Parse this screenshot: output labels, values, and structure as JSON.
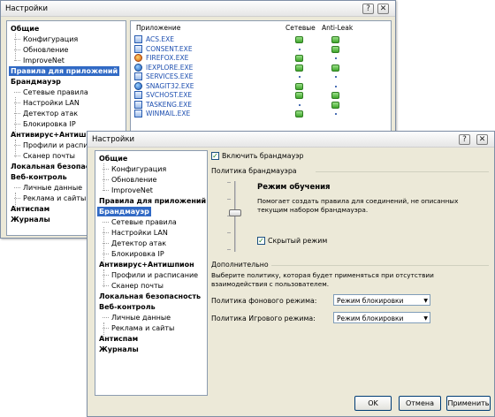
{
  "back_window": {
    "title": "Настройки",
    "title_buttons": [
      "?",
      "✕"
    ],
    "tree": [
      {
        "label": "Общие",
        "kind": "bold"
      },
      {
        "label": "Конфигурация",
        "kind": "child"
      },
      {
        "label": "Обновление",
        "kind": "child"
      },
      {
        "label": "ImproveNet",
        "kind": "child"
      },
      {
        "label": "Правила для приложений",
        "kind": "selected"
      },
      {
        "label": "Брандмауэр",
        "kind": "bold"
      },
      {
        "label": "Сетевые правила",
        "kind": "child"
      },
      {
        "label": "Настройки LAN",
        "kind": "child"
      },
      {
        "label": "Детектор атак",
        "kind": "child"
      },
      {
        "label": "Блокировка IP",
        "kind": "child"
      },
      {
        "label": "Антивирус+Антишпион",
        "kind": "bold"
      },
      {
        "label": "Профили и расписа",
        "kind": "child"
      },
      {
        "label": "Сканер почты",
        "kind": "child"
      },
      {
        "label": "Локальная безопаснос",
        "kind": "bold"
      },
      {
        "label": "Веб-контроль",
        "kind": "bold"
      },
      {
        "label": "Личные данные",
        "kind": "child"
      },
      {
        "label": "Реклама и сайты",
        "kind": "child"
      },
      {
        "label": "Антиспам",
        "kind": "bold"
      },
      {
        "label": "Журналы",
        "kind": "bold"
      }
    ],
    "columns": {
      "app": "Приложение",
      "net": "Сетевые",
      "leak": "Anti-Leak"
    },
    "apps": [
      {
        "name": "ACS.EXE",
        "icon": "window-icon",
        "net": "allow",
        "leak": "allow"
      },
      {
        "name": "CONSENT.EXE",
        "icon": "window-icon",
        "net": "none",
        "leak": "allow"
      },
      {
        "name": "FIREFOX.EXE",
        "icon": "firefox-icon",
        "net": "allow",
        "leak": "none"
      },
      {
        "name": "IEXPLORE.EXE",
        "icon": "ie-icon",
        "net": "allow",
        "leak": "allow"
      },
      {
        "name": "SERVICES.EXE",
        "icon": "window-icon",
        "net": "none",
        "leak": "none"
      },
      {
        "name": "SNAGIT32.EXE",
        "icon": "globe-icon",
        "net": "allow",
        "leak": "none"
      },
      {
        "name": "SVCHOST.EXE",
        "icon": "window-icon",
        "net": "allow",
        "leak": "allow"
      },
      {
        "name": "TASKENG.EXE",
        "icon": "window-icon",
        "net": "none",
        "leak": "allow"
      },
      {
        "name": "WINMAIL.EXE",
        "icon": "mail-icon",
        "net": "allow",
        "leak": "none"
      }
    ]
  },
  "front_window": {
    "title": "Настройки",
    "title_buttons": [
      "?",
      "✕"
    ],
    "tree": [
      {
        "label": "Общие",
        "kind": "bold"
      },
      {
        "label": "Конфигурация",
        "kind": "child"
      },
      {
        "label": "Обновление",
        "kind": "child"
      },
      {
        "label": "ImproveNet",
        "kind": "child"
      },
      {
        "label": "Правила для приложений",
        "kind": "bold"
      },
      {
        "label": "Брандмауэр",
        "kind": "selected"
      },
      {
        "label": "Сетевые правила",
        "kind": "child"
      },
      {
        "label": "Настройки LAN",
        "kind": "child"
      },
      {
        "label": "Детектор атак",
        "kind": "child"
      },
      {
        "label": "Блокировка IP",
        "kind": "child"
      },
      {
        "label": "Антивирус+Антишпион",
        "kind": "bold"
      },
      {
        "label": "Профили и расписание",
        "kind": "child"
      },
      {
        "label": "Сканер почты",
        "kind": "child"
      },
      {
        "label": "Локальная безопасность",
        "kind": "bold"
      },
      {
        "label": "Веб-контроль",
        "kind": "bold"
      },
      {
        "label": "Личные данные",
        "kind": "child"
      },
      {
        "label": "Реклама и сайты",
        "kind": "child"
      },
      {
        "label": "Антиспам",
        "kind": "bold"
      },
      {
        "label": "Журналы",
        "kind": "bold"
      }
    ],
    "enable_firewall": {
      "label": "Включить брандмауэр",
      "checked": true
    },
    "policy_group": "Политика брандмауэра",
    "mode_title": "Режим обучения",
    "mode_desc": "Помогает создать правила для соединений, не описанных текущим набором брандмауэра.",
    "stealth": {
      "label": "Скрытый режим",
      "checked": true
    },
    "slider_level": 0.5,
    "advanced_group": "Дополнительно",
    "advanced_desc": "Выберите политику, которая будет применяться при отсутствии взаимодействия с пользователем.",
    "bg_policy": {
      "label": "Политика фонового режима:",
      "value": "Режим блокировки"
    },
    "game_policy": {
      "label": "Политика Игрового режима:",
      "value": "Режим блокировки"
    },
    "buttons": {
      "ok": "OK",
      "cancel": "Отмена",
      "apply": "Применить"
    }
  },
  "colors": {
    "selection": "#316ac5",
    "link": "#1e4fb0",
    "allow": "#3fa62b"
  }
}
